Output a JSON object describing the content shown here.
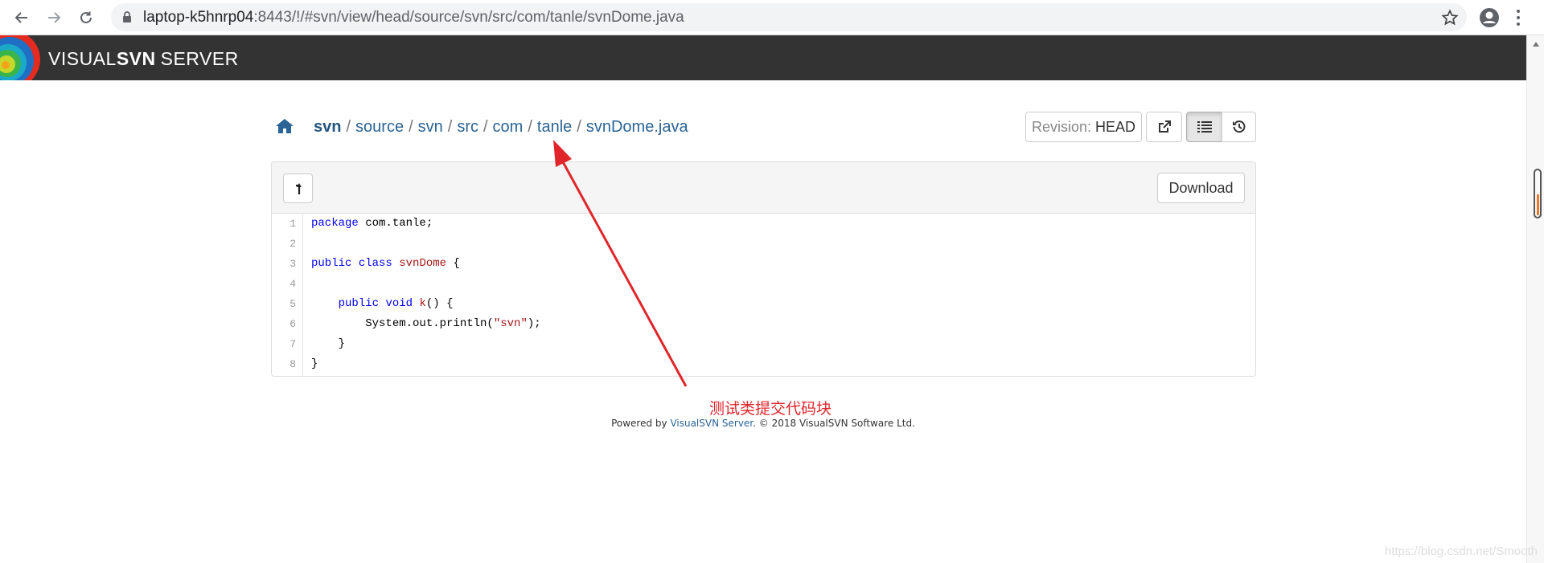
{
  "browser": {
    "url_host": "laptop-k5hnrp04",
    "url_rest": ":8443/!/#svn/view/head/source/svn/src/com/tanle/svnDome.java",
    "icons": [
      "back-icon",
      "forward-icon",
      "reload-icon",
      "lock-icon",
      "star-icon",
      "account-icon",
      "menu-icon"
    ]
  },
  "header": {
    "brand_visual": "VISUAL",
    "brand_svn": "SVN",
    "brand_server": "SERVER"
  },
  "breadcrumb": {
    "items": [
      "svn",
      "source",
      "svn",
      "src",
      "com",
      "tanle",
      "svnDome.java"
    ],
    "separator": "/"
  },
  "toolbar": {
    "revision_label": "Revision:",
    "revision_value": "HEAD"
  },
  "panel": {
    "download_label": "Download"
  },
  "code": {
    "lines": [
      [
        {
          "t": "package",
          "c": "kw"
        },
        {
          "t": " com.tanle;",
          "c": ""
        }
      ],
      [],
      [
        {
          "t": "public",
          "c": "kw"
        },
        {
          "t": " ",
          "c": ""
        },
        {
          "t": "class",
          "c": "kw"
        },
        {
          "t": " ",
          "c": ""
        },
        {
          "t": "svnDome",
          "c": "cls"
        },
        {
          "t": " {",
          "c": ""
        }
      ],
      [],
      [
        {
          "t": "    ",
          "c": ""
        },
        {
          "t": "public",
          "c": "kw"
        },
        {
          "t": " ",
          "c": ""
        },
        {
          "t": "void",
          "c": "kw"
        },
        {
          "t": " ",
          "c": ""
        },
        {
          "t": "k",
          "c": "cls"
        },
        {
          "t": "() {",
          "c": ""
        }
      ],
      [
        {
          "t": "        System.out.println(",
          "c": ""
        },
        {
          "t": "\"svn\"",
          "c": "str"
        },
        {
          "t": ");",
          "c": ""
        }
      ],
      [
        {
          "t": "    }",
          "c": ""
        }
      ],
      [
        {
          "t": "}",
          "c": ""
        }
      ]
    ]
  },
  "annotation": {
    "text": "测试类提交代码块"
  },
  "footer": {
    "prefix": "Powered by ",
    "link": "VisualSVN Server",
    "suffix": ". © 2018 VisualSVN Software Ltd."
  },
  "watermark": "https://blog.csdn.net/Smooth",
  "colors": {
    "header_bg": "#333333",
    "link": "#2a6496",
    "annotation": "#e0262b"
  }
}
